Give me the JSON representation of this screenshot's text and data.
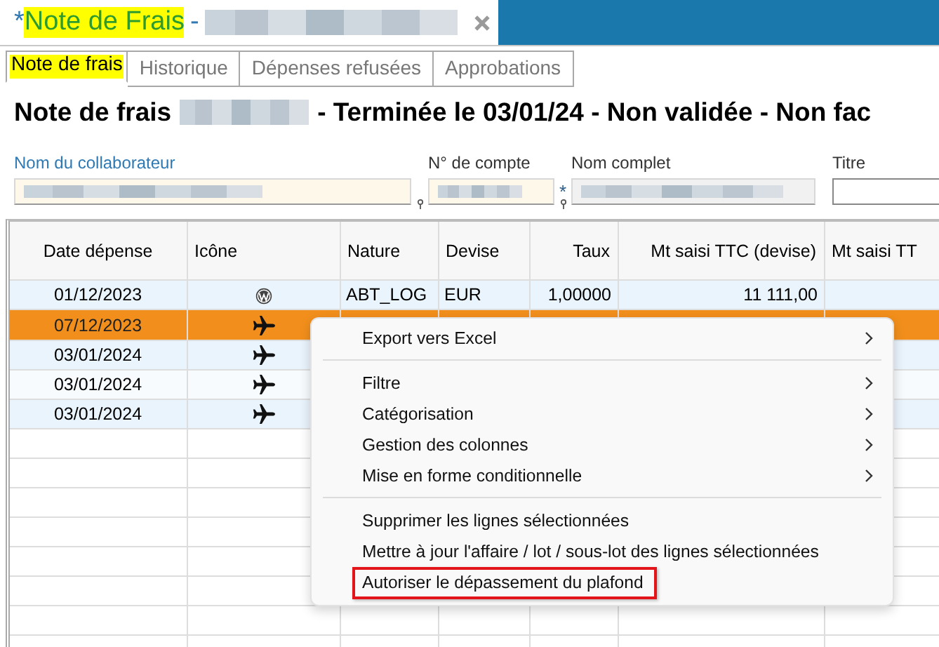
{
  "window": {
    "title": {
      "modified_mark": "*",
      "name": "Note de Frais",
      "separator": "-",
      "highlighted": true,
      "redacted_suffix": true
    }
  },
  "tabs": [
    {
      "label": "Note de frais",
      "selected": true,
      "highlighted": true
    },
    {
      "label": "Historique",
      "selected": false,
      "highlighted": false
    },
    {
      "label": "Dépenses refusées",
      "selected": false,
      "highlighted": false
    },
    {
      "label": "Approbations",
      "selected": false,
      "highlighted": false
    }
  ],
  "heading": {
    "prefix": "Note de frais",
    "redacted_name": true,
    "suffix": "- Terminée le 03/01/24 - Non validée - Non fac"
  },
  "fields": [
    {
      "label": "Nom du collaborateur",
      "kind": "required",
      "emphasized": true,
      "redacted": true,
      "pinned": true
    },
    {
      "label": "N° de compte",
      "kind": "required",
      "emphasized": false,
      "redacted": true,
      "pinned": true,
      "marker": "*"
    },
    {
      "label": "Nom complet",
      "kind": "readonly",
      "emphasized": false,
      "redacted": true,
      "pinned": false
    },
    {
      "label": "Titre",
      "kind": "plain",
      "emphasized": false,
      "redacted": false,
      "pinned": false
    }
  ],
  "table": {
    "columns": [
      "Date dépense",
      "Icône",
      "Nature",
      "Devise",
      "Taux",
      "Mt saisi TTC (devise)",
      "Mt saisi TT"
    ],
    "rows": [
      {
        "selected": false,
        "kind": "logo",
        "cells": [
          "01/12/2023",
          "",
          "ABT_LOG",
          "EUR",
          "1,00000",
          "11 111,00"
        ]
      },
      {
        "selected": true,
        "kind": "plane",
        "cells": [
          "07/12/2023",
          ""
        ]
      },
      {
        "selected": false,
        "kind": "plane",
        "cells": [
          "03/01/2024",
          ""
        ]
      },
      {
        "selected": false,
        "kind": "plane",
        "cells": [
          "03/01/2024",
          ""
        ]
      },
      {
        "selected": false,
        "kind": "plane",
        "cells": [
          "03/01/2024",
          ""
        ]
      }
    ]
  },
  "context_menu": {
    "items": [
      {
        "kind": "item",
        "label": "Export vers Excel",
        "submenu": true,
        "highlighted": false
      },
      {
        "kind": "separator"
      },
      {
        "kind": "item",
        "label": "Filtre",
        "submenu": true,
        "highlighted": false
      },
      {
        "kind": "item",
        "label": "Catégorisation",
        "submenu": true,
        "highlighted": false
      },
      {
        "kind": "item",
        "label": "Gestion des colonnes",
        "submenu": true,
        "highlighted": false
      },
      {
        "kind": "item",
        "label": "Mise en forme conditionnelle",
        "submenu": true,
        "highlighted": false
      },
      {
        "kind": "separator"
      },
      {
        "kind": "item",
        "label": "Supprimer les lignes sélectionnées",
        "submenu": false,
        "highlighted": false
      },
      {
        "kind": "item",
        "label": "Mettre à jour l'affaire / lot / sous-lot des lignes sélectionnées",
        "submenu": false,
        "highlighted": false
      },
      {
        "kind": "item",
        "label": "Autoriser le dépassement du plafond",
        "submenu": false,
        "highlighted": true
      }
    ]
  }
}
